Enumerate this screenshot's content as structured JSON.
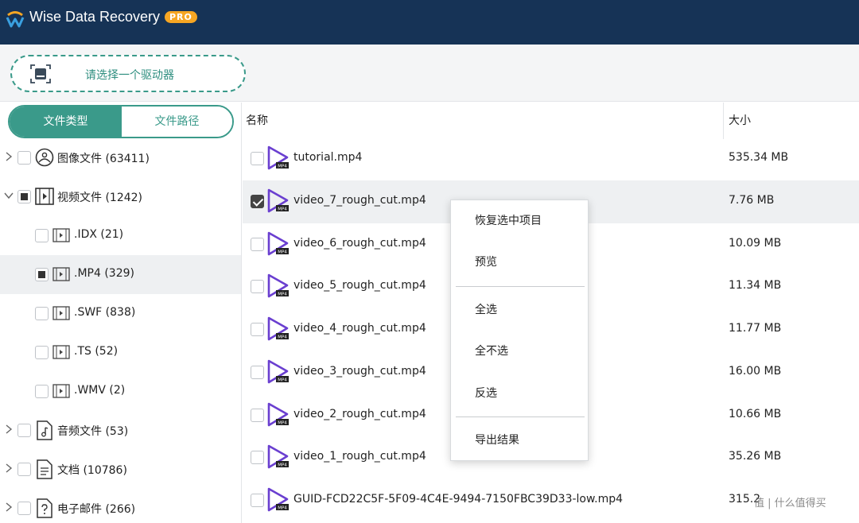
{
  "app": {
    "title": "Wise Data Recovery",
    "badge": "PRO",
    "colors": {
      "titlebar": "#163356",
      "accent": "#3a9a8a",
      "badge": "#f6a623"
    }
  },
  "toolbar": {
    "drive_select_label": "请选择一个驱动器",
    "drive_icon": "drive-icon"
  },
  "left": {
    "tabs": [
      {
        "label": "文件类型",
        "active": true
      },
      {
        "label": "文件路径",
        "active": false
      }
    ],
    "tree": [
      {
        "label": "图像文件 (63411)",
        "icon": "image-icon",
        "expanded": false,
        "level": 0,
        "check": "none"
      },
      {
        "label": "视频文件 (1242)",
        "icon": "video-folder-icon",
        "expanded": true,
        "level": 0,
        "check": "partial"
      },
      {
        "label": ".IDX (21)",
        "icon": "film-icon",
        "level": 1,
        "check": "none"
      },
      {
        "label": ".MP4 (329)",
        "icon": "film-icon",
        "level": 1,
        "check": "partial",
        "selected": true
      },
      {
        "label": ".SWF (838)",
        "icon": "film-icon",
        "level": 1,
        "check": "none"
      },
      {
        "label": ".TS (52)",
        "icon": "film-icon",
        "level": 1,
        "check": "none"
      },
      {
        "label": ".WMV (2)",
        "icon": "film-icon",
        "level": 1,
        "check": "none"
      },
      {
        "label": "音频文件 (53)",
        "icon": "music-icon",
        "expanded": false,
        "level": 0,
        "check": "none"
      },
      {
        "label": "文档 (10786)",
        "icon": "document-icon",
        "expanded": false,
        "level": 0,
        "check": "none"
      },
      {
        "label": "电子邮件 (266)",
        "icon": "email-icon",
        "expanded": false,
        "level": 0,
        "check": "none"
      }
    ]
  },
  "files": {
    "columns": {
      "name": "名称",
      "size": "大小"
    },
    "rows": [
      {
        "name": "tutorial.mp4",
        "size": "535.34 MB",
        "checked": false
      },
      {
        "name": "video_7_rough_cut.mp4",
        "size": "7.76 MB",
        "checked": true,
        "selected": true
      },
      {
        "name": "video_6_rough_cut.mp4",
        "size": "10.09 MB",
        "checked": false
      },
      {
        "name": "video_5_rough_cut.mp4",
        "size": "11.34 MB",
        "checked": false
      },
      {
        "name": "video_4_rough_cut.mp4",
        "size": "11.77 MB",
        "checked": false
      },
      {
        "name": "video_3_rough_cut.mp4",
        "size": "16.00 MB",
        "checked": false
      },
      {
        "name": "video_2_rough_cut.mp4",
        "size": "10.66 MB",
        "checked": false
      },
      {
        "name": "video_1_rough_cut.mp4",
        "size": "35.26 MB",
        "checked": false
      },
      {
        "name": "GUID-FCD22C5F-5F09-4C4E-9494-7150FBC39D33-low.mp4",
        "size": "315.2",
        "checked": false
      }
    ]
  },
  "context_menu": {
    "group1": [
      "恢复选中项目",
      "预览"
    ],
    "group2": [
      "全选",
      "全不选",
      "反选"
    ],
    "group3": [
      "导出结果"
    ]
  },
  "watermark": "值 | 什么值得买"
}
